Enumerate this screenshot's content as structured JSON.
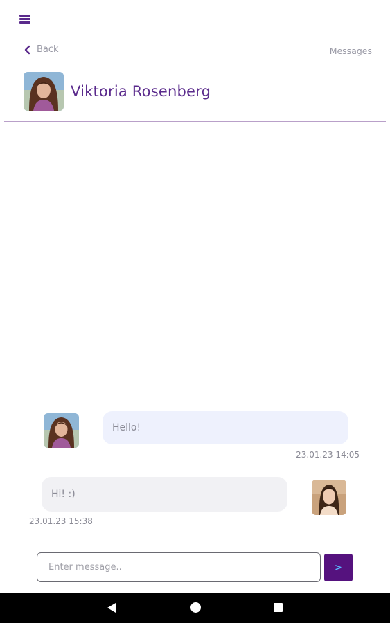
{
  "nav": {
    "menu_icon": "hamburger-menu-icon",
    "back_label": "Back",
    "back_icon": "chevron-left-icon",
    "messages_label": "Messages"
  },
  "contact": {
    "name": "Viktoria Rosenberg"
  },
  "messages": [
    {
      "direction": "incoming",
      "text": "Hello!",
      "time": "23.01.23 14:05"
    },
    {
      "direction": "outgoing",
      "text": "Hi! :)",
      "time": "23.01.23 15:38"
    }
  ],
  "composer": {
    "placeholder": "Enter message..",
    "value": "",
    "send_label": ">"
  },
  "colors": {
    "accent": "#5a2a8c",
    "send_button": "#55127e",
    "divider": "#b9a0c9",
    "incoming_bubble": "#eef1fd",
    "outgoing_bubble": "#f1f1f4"
  },
  "system_nav": {
    "back_icon": "triangle-back-icon",
    "home_icon": "circle-home-icon",
    "recents_icon": "square-recents-icon"
  }
}
